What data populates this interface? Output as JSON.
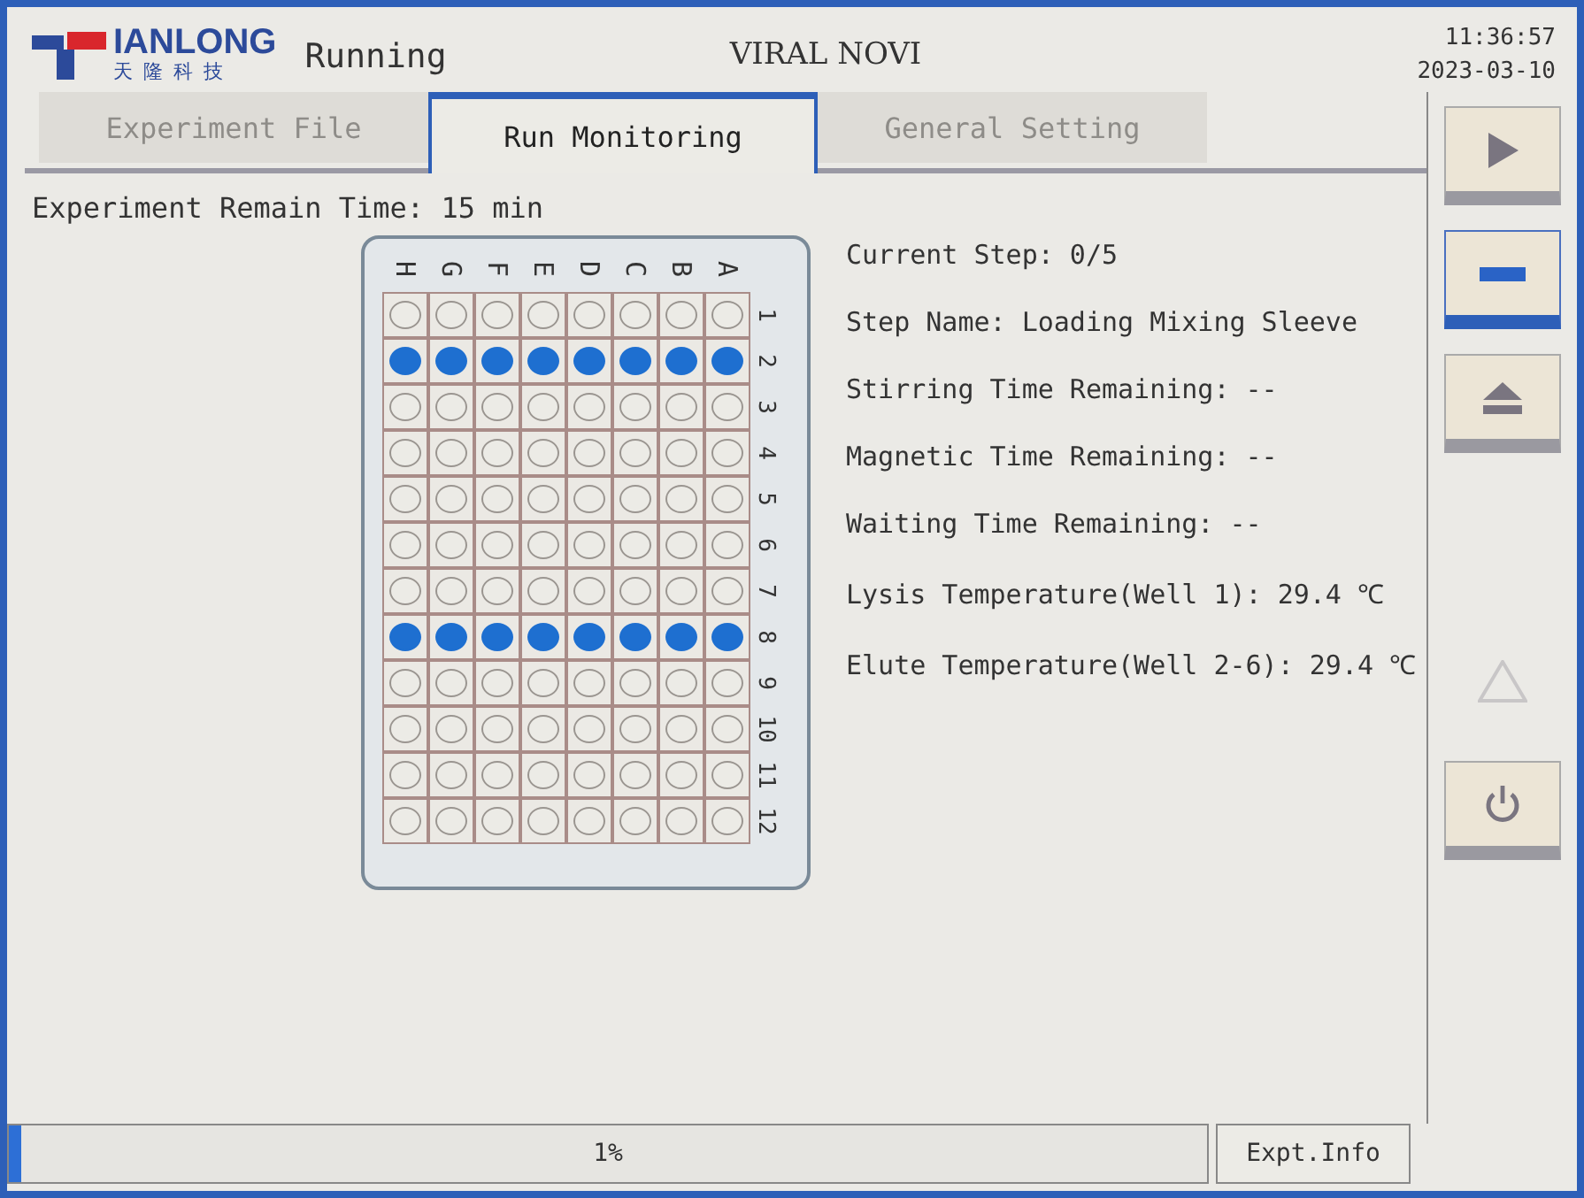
{
  "header": {
    "logo_text": "IANLONG",
    "logo_subtext": "天隆科技",
    "status": "Running",
    "title": "VIRAL NOVI",
    "time": "11:36:57",
    "date": "2023-03-10"
  },
  "tabs": [
    {
      "label": "Experiment File",
      "selected": false,
      "disabled": true
    },
    {
      "label": "Run Monitoring",
      "selected": true,
      "disabled": false
    },
    {
      "label": "General Setting",
      "selected": false,
      "disabled": true
    }
  ],
  "remain_time": "Experiment Remain Time: 15 min",
  "plate": {
    "columns": [
      "H",
      "G",
      "F",
      "E",
      "D",
      "C",
      "B",
      "A"
    ],
    "rows": [
      {
        "label": "1",
        "filled": false
      },
      {
        "label": "2",
        "filled": true
      },
      {
        "label": "3",
        "filled": false
      },
      {
        "label": "4",
        "filled": false
      },
      {
        "label": "5",
        "filled": false
      },
      {
        "label": "6",
        "filled": false
      },
      {
        "label": "7",
        "filled": false
      },
      {
        "label": "8",
        "filled": true
      },
      {
        "label": "9",
        "filled": false
      },
      {
        "label": "10",
        "filled": false
      },
      {
        "label": "11",
        "filled": false
      },
      {
        "label": "12",
        "filled": false
      }
    ]
  },
  "info_lines": [
    "Current Step: 0/5",
    "Step Name: Loading Mixing Sleeve",
    "Stirring Time Remaining: --",
    "Magnetic Time Remaining: --",
    "Waiting Time Remaining: --",
    "Lysis Temperature(Well 1): 29.4 ℃",
    "Elute Temperature(Well 2-6): 29.4 ℃"
  ],
  "side_buttons": [
    {
      "kind": "play",
      "selected": false,
      "disabled": false
    },
    {
      "kind": "pause",
      "selected": true,
      "disabled": false
    },
    {
      "kind": "eject",
      "selected": false,
      "disabled": false
    },
    {
      "kind": "warning",
      "selected": false,
      "disabled": true
    },
    {
      "kind": "power",
      "selected": false,
      "disabled": false
    }
  ],
  "progress": {
    "level": 0.01,
    "reading": "1%"
  },
  "info_button": "Expt.Info"
}
